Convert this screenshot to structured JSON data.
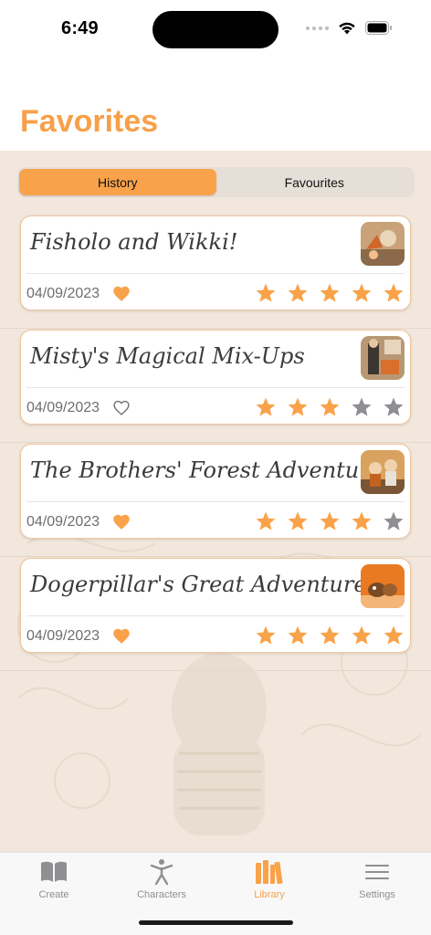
{
  "status": {
    "time": "6:49"
  },
  "header": {
    "title": "Favorites"
  },
  "segments": [
    {
      "label": "History",
      "active": true
    },
    {
      "label": "Favourites",
      "active": false
    }
  ],
  "stories": [
    {
      "title": "Fisholo and Wikki!",
      "date": "04/09/2023",
      "favorite": true,
      "rating": 5
    },
    {
      "title": "Misty's Magical Mix-Ups",
      "date": "04/09/2023",
      "favorite": false,
      "rating": 3
    },
    {
      "title": "The Brothers' Forest Adventure",
      "date": "04/09/2023",
      "favorite": true,
      "rating": 4
    },
    {
      "title": "Dogerpillar's Great Adventure",
      "date": "04/09/2023",
      "favorite": true,
      "rating": 5
    }
  ],
  "tabs": [
    {
      "label": "Create",
      "icon": "book-icon",
      "active": false
    },
    {
      "label": "Characters",
      "icon": "person-icon",
      "active": false
    },
    {
      "label": "Library",
      "icon": "library-icon",
      "active": true
    },
    {
      "label": "Settings",
      "icon": "menu-lines-icon",
      "active": false
    }
  ],
  "colors": {
    "accent": "#f9a24a",
    "star_off": "#8e8e93",
    "title": "#f7a04a"
  }
}
